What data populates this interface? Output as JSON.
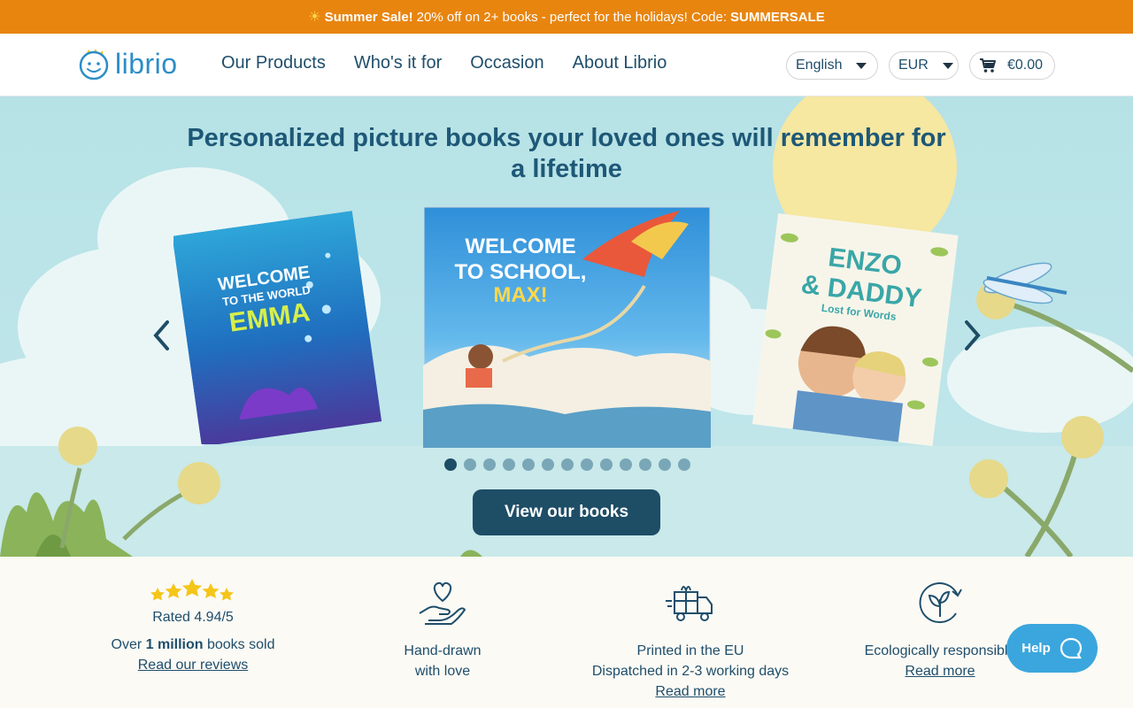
{
  "promo": {
    "icon": "sun-icon",
    "bold": "Summer Sale!",
    "text": "20% off on 2+ books - perfect for the holidays! Code:",
    "code": "SUMMERSALE"
  },
  "header": {
    "logo_text": "librio",
    "nav": [
      "Our Products",
      "Who's it for",
      "Occasion",
      "About Librio"
    ],
    "language": "English",
    "currency": "EUR",
    "cart_total": "€0.00"
  },
  "hero": {
    "title": "Personalized picture books your loved ones will remember for a lifetime",
    "books": [
      {
        "line1": "WELCOME",
        "line2": "TO THE WORLD",
        "name": "EMMA"
      },
      {
        "line1": "WELCOME",
        "line2": "TO SCHOOL,",
        "name": "MAX!"
      },
      {
        "line1": "ENZO",
        "line2": "& DADDY",
        "subtitle": "Lost for Words"
      }
    ],
    "dot_count": 13,
    "active_dot": 0,
    "cta": "View our books"
  },
  "features": {
    "rating": "Rated 4.94/5",
    "sold_prefix": "Over",
    "sold_bold": "1 million",
    "sold_suffix": "books sold",
    "reviews_link": "Read our reviews",
    "hand_line1": "Hand-drawn",
    "hand_line2": "with love",
    "eu_line1": "Printed in the EU",
    "eu_line2": "Dispatched in 2-3 working days",
    "eu_link": "Read more",
    "eco_line1": "Ecologically responsible",
    "eco_link": "Read more"
  },
  "help": {
    "label": "Help"
  },
  "colors": {
    "promo": "#e8850f",
    "primary": "#1e4d66",
    "help": "#3ba6dd",
    "star": "#f5c518"
  }
}
